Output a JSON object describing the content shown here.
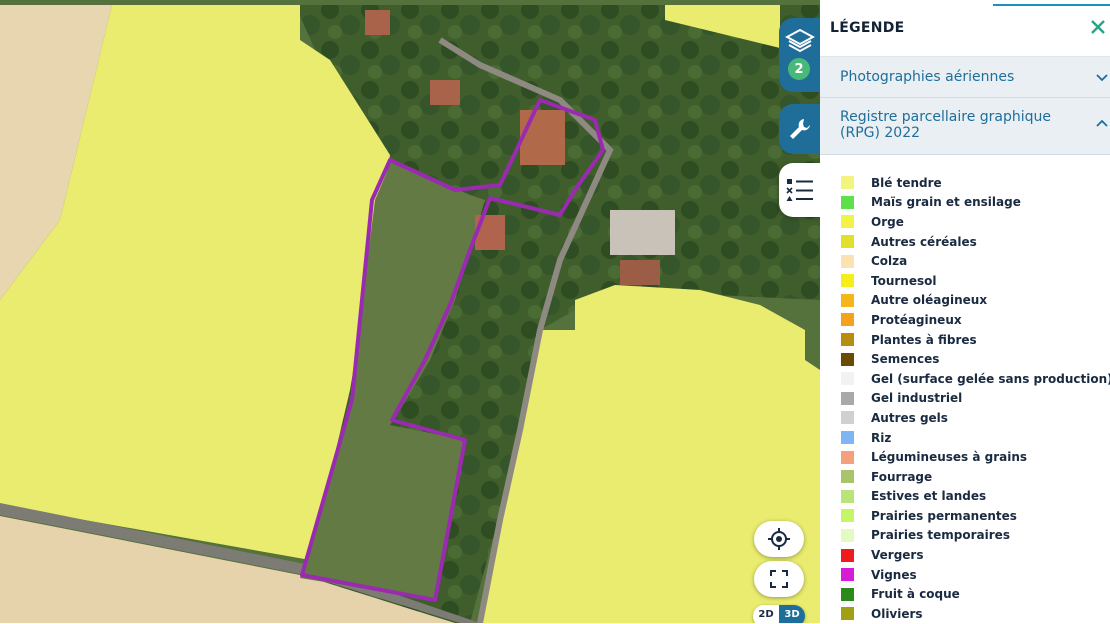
{
  "legend": {
    "title": "LÉGENDE",
    "close_icon": "close-icon",
    "sections": {
      "aerial": {
        "label": "Photographies aériennes",
        "expanded": false
      },
      "rpg": {
        "label": "Registre parcellaire graphique (RPG) 2022",
        "expanded": true
      }
    },
    "items": [
      {
        "label": "Blé tendre",
        "color": "#f2f47e"
      },
      {
        "label": "Maïs grain et ensilage",
        "color": "#5ee04a"
      },
      {
        "label": "Orge",
        "color": "#f2f247"
      },
      {
        "label": "Autres céréales",
        "color": "#e2e02a"
      },
      {
        "label": "Colza",
        "color": "#fbe3b0"
      },
      {
        "label": "Tournesol",
        "color": "#f6ee1c"
      },
      {
        "label": "Autre oléagineux",
        "color": "#f4b61a"
      },
      {
        "label": "Protéagineux",
        "color": "#f2a31b"
      },
      {
        "label": "Plantes à fibres",
        "color": "#b88b12"
      },
      {
        "label": "Semences",
        "color": "#6b4a06"
      },
      {
        "label": "Gel (surface gelée sans production)",
        "color": "#f2f2f2"
      },
      {
        "label": "Gel industriel",
        "color": "#a9a9a9"
      },
      {
        "label": "Autres gels",
        "color": "#d0d0d0"
      },
      {
        "label": "Riz",
        "color": "#7eb6f4"
      },
      {
        "label": "Légumineuses à grains",
        "color": "#f4a07e"
      },
      {
        "label": "Fourrage",
        "color": "#a9c46a"
      },
      {
        "label": "Estives et landes",
        "color": "#b8e47a"
      },
      {
        "label": "Prairies permanentes",
        "color": "#c8f46a"
      },
      {
        "label": "Prairies temporaires",
        "color": "#e3fac0"
      },
      {
        "label": "Vergers",
        "color": "#ee1c1c"
      },
      {
        "label": "Vignes",
        "color": "#d61cd6"
      },
      {
        "label": "Fruit à coque",
        "color": "#2a8a1a"
      },
      {
        "label": "Oliviers",
        "color": "#a0a012"
      }
    ]
  },
  "tools": {
    "layers": {
      "icon": "layers-icon",
      "count": "2"
    },
    "tools": {
      "icon": "wrench-icon"
    },
    "legend": {
      "icon": "legend-list-icon"
    }
  },
  "map_controls": {
    "locate": {
      "icon": "locate-icon"
    },
    "fullscreen": {
      "icon": "fullscreen-icon"
    },
    "view_2d": "2D",
    "view_3d": "3D"
  },
  "colors": {
    "accent": "#1f6e9a",
    "badge": "#49b97a",
    "parcel_outline": "#9a2bb0",
    "crop_yellow": "#e9ec6e"
  }
}
